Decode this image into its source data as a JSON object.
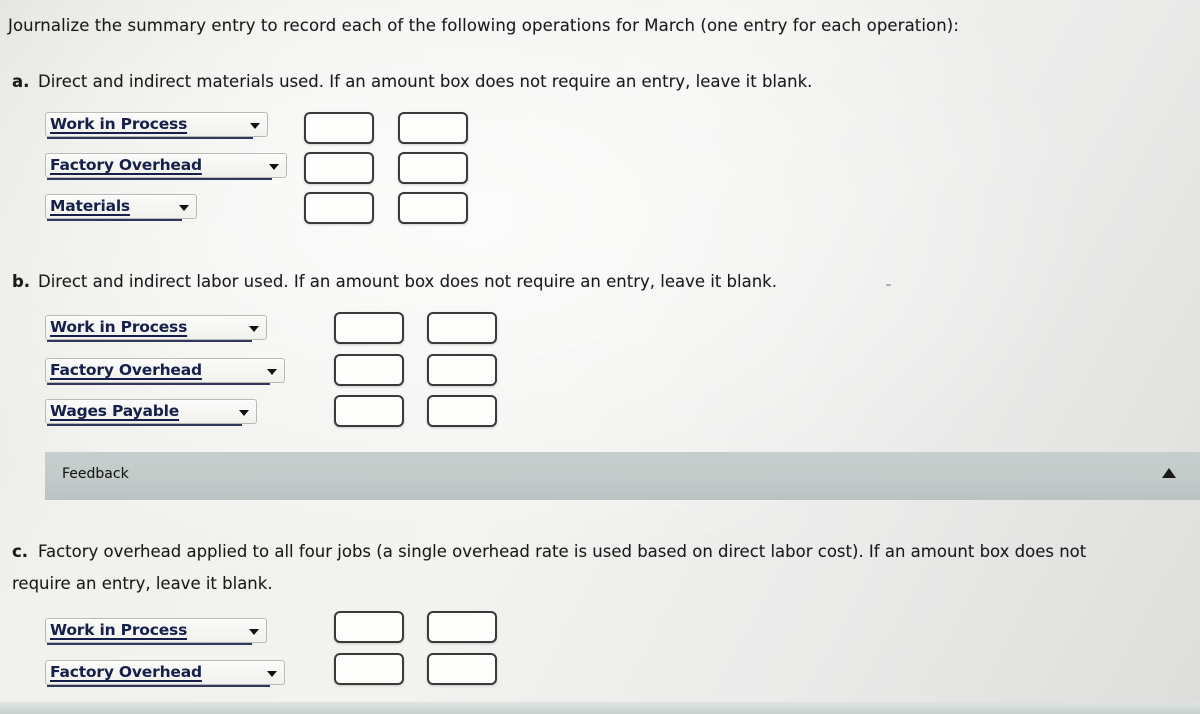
{
  "title": "Journalize the summary entry to record each of the following operations for March (one entry for each operation):",
  "parts": [
    {
      "marker": "a.",
      "text": "Direct and indirect materials used. If an amount box does not require an entry, leave it blank.",
      "rows": [
        {
          "account": "Work in Process",
          "debit": "",
          "credit": ""
        },
        {
          "account": "Factory Overhead",
          "debit": "",
          "credit": ""
        },
        {
          "account": "Materials",
          "debit": "",
          "credit": ""
        }
      ]
    },
    {
      "marker": "b.",
      "text": "Direct and indirect labor used. If an amount box does not require an entry, leave it blank.",
      "rows": [
        {
          "account": "Work in Process",
          "debit": "",
          "credit": ""
        },
        {
          "account": "Factory Overhead",
          "debit": "",
          "credit": ""
        },
        {
          "account": "Wages Payable",
          "debit": "",
          "credit": ""
        }
      ]
    },
    {
      "marker": "c.",
      "text_line1": "Factory overhead applied to all four jobs (a single overhead rate is used based on direct labor cost). If an amount box does not",
      "text_line2": "require an entry, leave it blank.",
      "rows": [
        {
          "account": "Work in Process",
          "debit": "",
          "credit": ""
        },
        {
          "account": "Factory Overhead",
          "debit": "",
          "credit": ""
        }
      ]
    }
  ],
  "feedback": {
    "label": "Feedback",
    "toggle_icon": "triangle-up-icon"
  },
  "colors": {
    "account_text": "#16204a",
    "body_text": "#1a1a1a",
    "feedback_bar": "#c2cbc9",
    "page_background": "#f1f1ee",
    "amount_box_border": "#3a3a3a"
  },
  "icons": {
    "dropdown_caret": "chevron-down-icon"
  }
}
